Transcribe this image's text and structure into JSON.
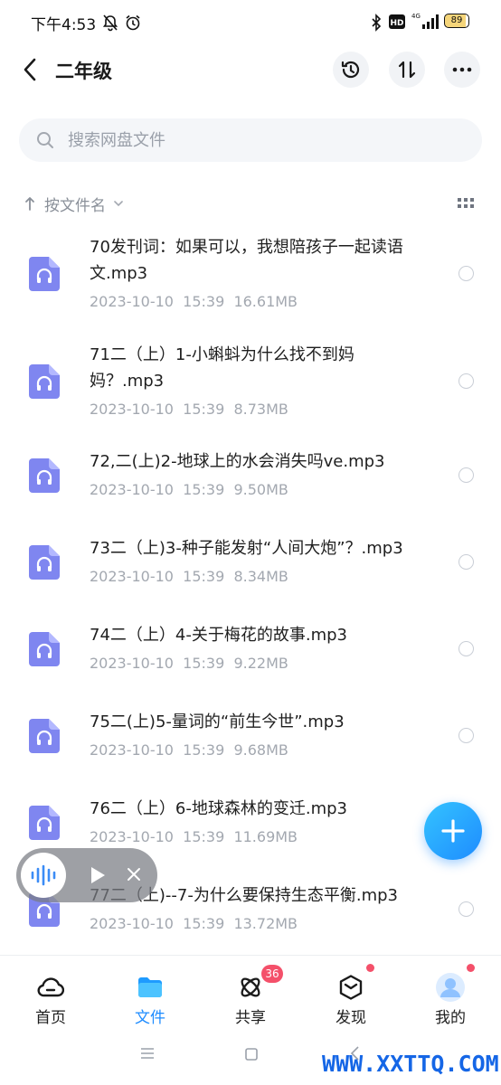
{
  "status": {
    "time": "下午4:53",
    "battery": "89",
    "network": "4G"
  },
  "header": {
    "title": "二年级"
  },
  "search": {
    "placeholder": "搜索网盘文件"
  },
  "sort": {
    "label": "按文件名"
  },
  "files": [
    {
      "name": "70发刊词：如果可以，我想陪孩子一起读语文.mp3",
      "date": "2023-10-10  15:39",
      "size": "16.61MB"
    },
    {
      "name": "71二（上）1-小蝌蚪为什么找不到妈妈？.mp3",
      "date": "2023-10-10  15:39",
      "size": "8.73MB"
    },
    {
      "name": "72,二(上)2-地球上的水会消失吗ve.mp3",
      "date": "2023-10-10  15:39",
      "size": "9.50MB"
    },
    {
      "name": "73二（上)3-种子能发射“人间大炮”？.mp3",
      "date": "2023-10-10  15:39",
      "size": "8.34MB"
    },
    {
      "name": "74二（上）4-关于梅花的故事.mp3",
      "date": "2023-10-10  15:39",
      "size": "9.22MB"
    },
    {
      "name": "75二(上)5-量词的“前生今世”.mp3",
      "date": "2023-10-10  15:39",
      "size": "9.68MB"
    },
    {
      "name": "76二（上）6-地球森林的变迁.mp3",
      "date": "2023-10-10  15:39",
      "size": "11.69MB"
    },
    {
      "name": "77二（上)--7-为什么要保持生态平衡.mp3",
      "date": "2023-10-10  15:39",
      "size": "13.72MB"
    }
  ],
  "nav": {
    "items": [
      {
        "label": "首页",
        "icon": "cloud-icon"
      },
      {
        "label": "文件",
        "icon": "folder-icon"
      },
      {
        "label": "共享",
        "icon": "share-atom-icon"
      },
      {
        "label": "发现",
        "icon": "discover-cube-icon"
      },
      {
        "label": "我的",
        "icon": "avatar-icon"
      }
    ],
    "share_badge": "36"
  },
  "watermark": "WWW.XXTTQ.COM",
  "colors": {
    "accent": "#1e8cff",
    "file_icon": "#7f86f0",
    "badge": "#f4506a"
  }
}
